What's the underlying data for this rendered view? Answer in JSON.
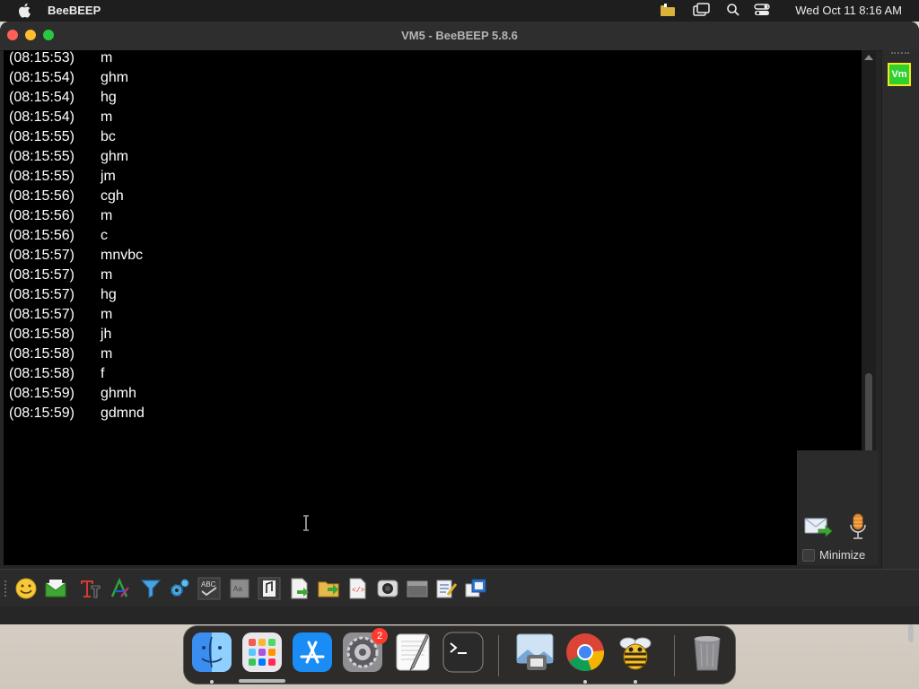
{
  "menubar": {
    "app_name": "BeeBEEP",
    "clock": "Wed Oct 11  8:16 AM",
    "icons": [
      "apple-icon",
      "status-folder-icon",
      "screen-mirror-icon",
      "spotlight-icon",
      "control-center-icon"
    ]
  },
  "window": {
    "title": "VM5 - BeeBEEP 5.8.6"
  },
  "chat": {
    "messages": [
      {
        "time": "(08:15:53)",
        "text": "m"
      },
      {
        "time": "(08:15:54)",
        "text": "ghm"
      },
      {
        "time": "(08:15:54)",
        "text": "hg"
      },
      {
        "time": "(08:15:54)",
        "text": "m"
      },
      {
        "time": "(08:15:55)",
        "text": "bc"
      },
      {
        "time": "(08:15:55)",
        "text": "ghm"
      },
      {
        "time": "(08:15:55)",
        "text": "jm"
      },
      {
        "time": "(08:15:56)",
        "text": "cgh"
      },
      {
        "time": "(08:15:56)",
        "text": "m"
      },
      {
        "time": "(08:15:56)",
        "text": "c"
      },
      {
        "time": "(08:15:57)",
        "text": "mnvbc"
      },
      {
        "time": "(08:15:57)",
        "text": "m"
      },
      {
        "time": "(08:15:57)",
        "text": "hg"
      },
      {
        "time": "(08:15:57)",
        "text": "m"
      },
      {
        "time": "(08:15:58)",
        "text": "jh"
      },
      {
        "time": "(08:15:58)",
        "text": "m"
      },
      {
        "time": "(08:15:58)",
        "text": "f"
      },
      {
        "time": "(08:15:59)",
        "text": "ghmh"
      },
      {
        "time": "(08:15:59)",
        "text": "gdmnd"
      }
    ]
  },
  "input": {
    "value": "",
    "minimize_label": "Minimize"
  },
  "users": {
    "avatar_initials": "Vm",
    "avatar_color": "#2fd12f",
    "avatar_border": "#f3e81b"
  },
  "toolbar": {
    "buttons": [
      "emoticons-icon",
      "send-email-icon",
      "font-icon",
      "font-color-icon",
      "filter-icon",
      "settings-icon",
      "spellcheck-icon",
      "word-completion-icon",
      "note-icon",
      "send-file-icon",
      "send-folder-icon",
      "code-icon",
      "screenshot-icon",
      "save-chat-icon",
      "clear-chat-icon",
      "detach-chat-icon"
    ]
  },
  "dock": {
    "items": [
      "finder",
      "launchpad",
      "app-store",
      "system-settings",
      "textedit",
      "terminal",
      "preview",
      "chrome",
      "beebeep",
      "trash"
    ],
    "badge_count": "2"
  },
  "colors": {
    "chat_bg": "#000000",
    "window_bg": "#262626",
    "close": "#ff5f57",
    "minimize": "#febc2e",
    "zoom": "#28c840"
  }
}
